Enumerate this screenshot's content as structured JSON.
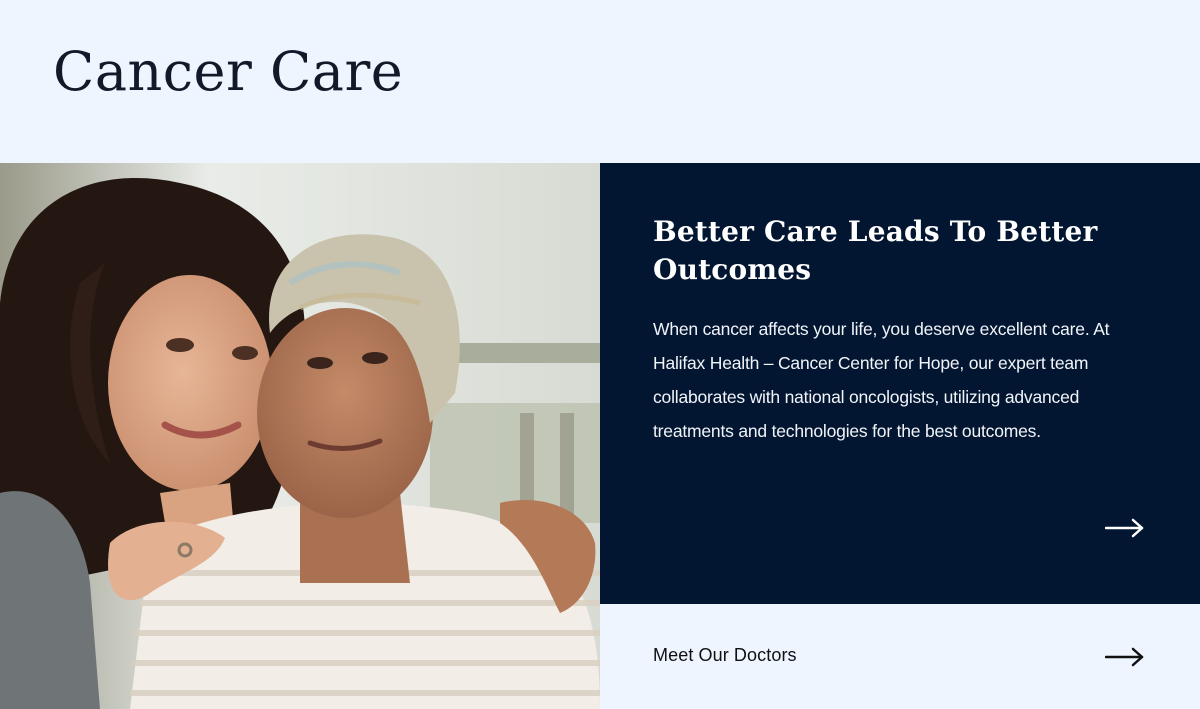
{
  "header": {
    "title": "Cancer Care"
  },
  "hero_image": {
    "alt": "Photo of a smiling young woman hugging an older woman wearing a head scarf"
  },
  "feature": {
    "heading": "Better Care Leads To Better Outcomes",
    "body": "When cancer affects your life, you deserve excellent care. At Halifax Health – Cancer Center for Hope, our expert team collaborates with national oncologists, utilizing advanced treatments and technologies for the best outcomes.",
    "arrow_icon": "arrow-right-icon",
    "background_color": "#031631"
  },
  "cta": {
    "label": "Meet Our Doctors",
    "arrow_icon": "arrow-right-icon"
  },
  "colors": {
    "page_background": "#eef5ff",
    "title_text": "#14192a",
    "panel": "#031631"
  }
}
